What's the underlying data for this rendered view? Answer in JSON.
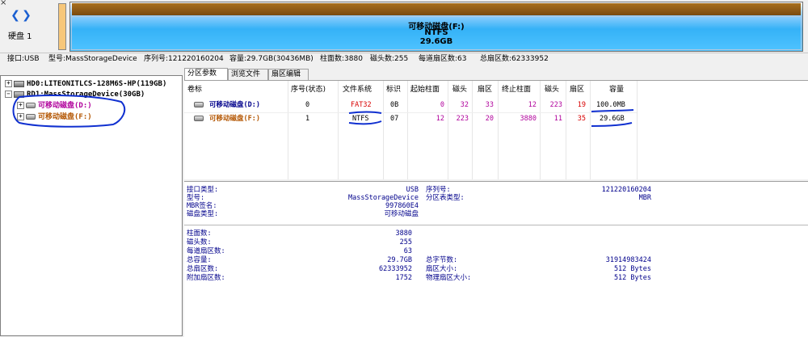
{
  "disk_panel": {
    "disk_label": "硬盘 1",
    "partition_name": "可移动磁盘(F:)",
    "partition_fs": "NTFS",
    "partition_size": "29.6GB"
  },
  "info_bar": {
    "interface": "接口:USB",
    "model": "型号:MassStorageDevice",
    "serial": "序列号:121220160204",
    "capacity": "容量:29.7GB(30436MB)",
    "cylinders": "柱面数:3880",
    "heads": "磁头数:255",
    "sectors_per_track": "每道扇区数:63",
    "total_sectors": "总扇区数:62333952"
  },
  "tree": {
    "hd0": "HD0:LITEONITLCS-128M6S-HP(119GB)",
    "rd1": "RD1:MassStorageDevice(30GB)",
    "part_d": "可移动磁盘(D:)",
    "part_f": "可移动磁盘(F:)"
  },
  "tabs": [
    "分区参数",
    "浏览文件",
    "扇区编辑"
  ],
  "table": {
    "headers": [
      "卷标",
      "序号(状态)",
      "文件系统",
      "标识",
      "起始柱面",
      "磁头",
      "扇区",
      "终止柱面",
      "磁头",
      "扇区",
      "容量"
    ],
    "rows": [
      [
        "可移动磁盘(D:)",
        "0",
        "FAT32",
        "0B",
        "0",
        "32",
        "33",
        "12",
        "223",
        "19",
        "100.0MB"
      ],
      [
        "可移动磁盘(F:)",
        "1",
        "NTFS",
        "07",
        "12",
        "223",
        "20",
        "3880",
        "11",
        "35",
        "29.6GB"
      ]
    ]
  },
  "details": {
    "interface_type_label": "接口类型:",
    "interface_type_value": "USB",
    "model_label": "型号:",
    "model_value": "MassStorageDevice",
    "mbr_sig_label": "MBR签名:",
    "mbr_sig_value": "997860E4",
    "disk_type_label": "磁盘类型:",
    "disk_type_value": "可移动磁盘",
    "serial_label": "序列号:",
    "serial_value": "121220160204",
    "ptable_type_label": "分区表类型:",
    "ptable_type_value": "MBR",
    "cylinders_label": "柱面数:",
    "cylinders_value": "3880",
    "heads_label": "磁头数:",
    "heads_value": "255",
    "spt_label": "每道扇区数:",
    "spt_value": "63",
    "total_cap_label": "总容量:",
    "total_cap_value": "29.7GB",
    "total_sectors_label": "总扇区数:",
    "total_sectors_value": "62333952",
    "extra_sectors_label": "附加扇区数:",
    "extra_sectors_value": "1752",
    "total_bytes_label": "总字节数:",
    "total_bytes_value": "31914983424",
    "sector_size_label": "扇区大小:",
    "sector_size_value": "512 Bytes",
    "phys_sector_label": "物理扇区大小:",
    "phys_sector_value": "512 Bytes"
  },
  "colors": {
    "partition_top": "#8a5a14",
    "partition_fill": "#35b2f7",
    "red_text": "#d80000",
    "purple_text": "#b0009b",
    "navy_text": "#00008b",
    "annotation_ink": "#1030d0"
  }
}
